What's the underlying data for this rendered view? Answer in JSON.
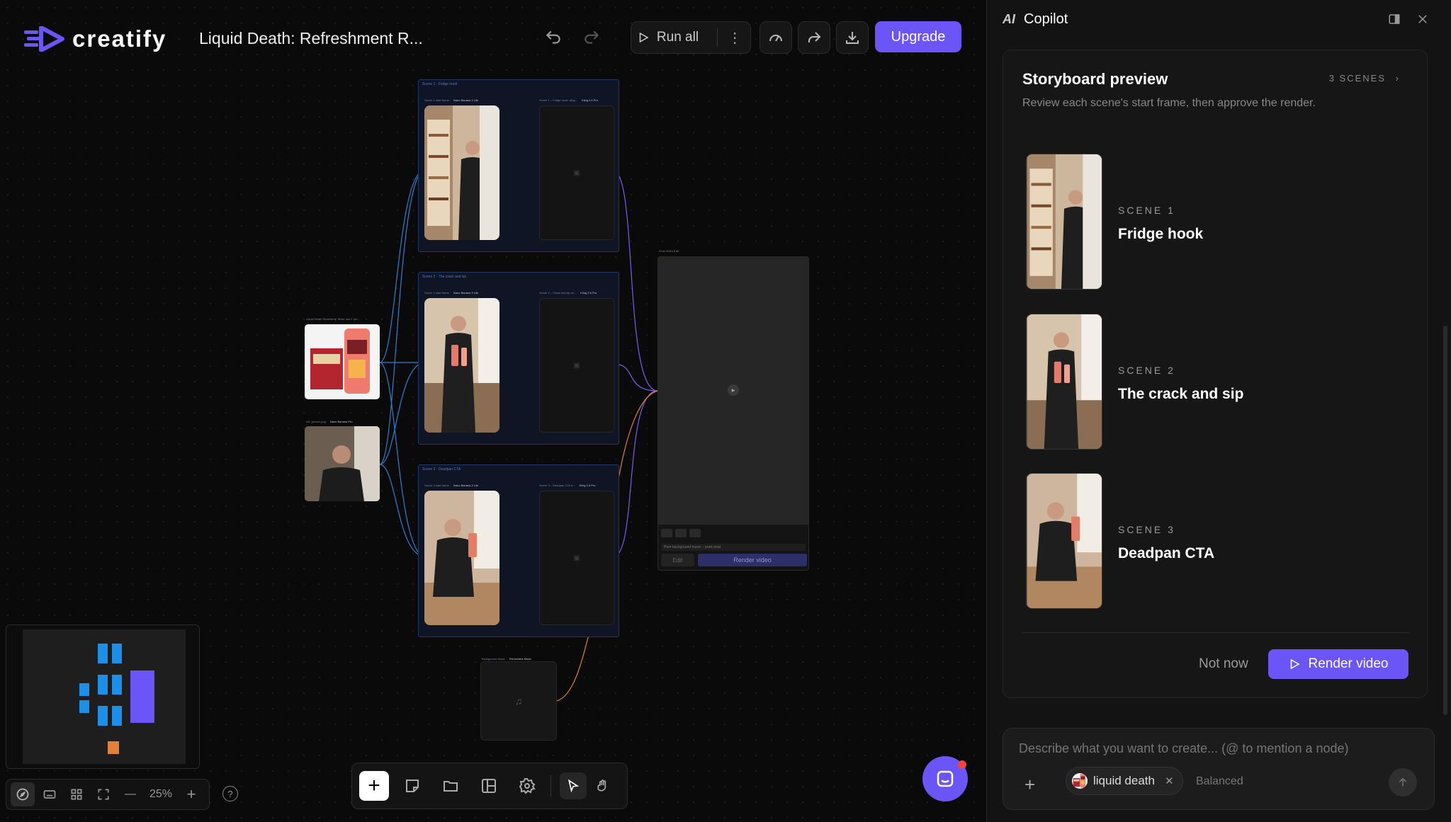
{
  "header": {
    "logo_text": "creatify",
    "project_title": "Liquid Death: Refreshment R...",
    "run_all_label": "Run all",
    "upgrade_label": "Upgrade"
  },
  "canvas": {
    "zoom_level": "25%",
    "groups": [
      {
        "label": "Scene 1 · Fridge hook",
        "start_label": "Scene 1 start frame",
        "start_model": "Nano Banana 2 Lite",
        "video_label": "Scene 1 – Fridge hook: sling...",
        "video_model": "Kling 2.6 Pro"
      },
      {
        "label": "Scene 2 · The crack and sip",
        "start_label": "Scene 2 start frame",
        "start_model": "Nano Banana 2 Lite",
        "video_label": "Scene 2 – Crack and sip sh...",
        "video_model": "Kling 2.6 Pro"
      },
      {
        "label": "Scene 3 · Deadpan CTA",
        "start_label": "Scene 3 start frame",
        "start_model": "Nano Banana 2 Lite",
        "video_label": "Scene 3 – Deadpan CTA d...",
        "video_model": "Kling 2.6 Pro"
      }
    ],
    "product_node_label": "Liquid Death Strawberry Tense can + pro...",
    "person_node_label": "AR_person.png",
    "person_node_model": "Nano Banana Pro",
    "final_node_label": "Final Video Edit",
    "final_prompt": "Pure background music – punk beat",
    "final_edit_label": "Edit",
    "final_render_label": "Render video",
    "audio_node_label": "Background Music",
    "audio_node_model": "Elevenlabs Music"
  },
  "copilot": {
    "title": "Copilot",
    "card_title": "Storyboard preview",
    "card_subtitle": "Review each scene's start frame, then approve the render.",
    "scenes_count": "3 SCENES",
    "scenes": [
      {
        "number": "SCENE 1",
        "name": "Fridge hook"
      },
      {
        "number": "SCENE 2",
        "name": "The crack and sip"
      },
      {
        "number": "SCENE 3",
        "name": "Deadpan CTA"
      }
    ],
    "not_now_label": "Not now",
    "render_label": "Render video",
    "input_placeholder": "Describe what you want to create... (@ to mention a node)",
    "chip_label": "liquid death",
    "mode_label": "Balanced"
  },
  "colors": {
    "accent": "#6c55f6",
    "wire_blue": "#2f7fd1",
    "wire_purple": "#7a5cf0",
    "wire_orange": "#e0803a"
  }
}
